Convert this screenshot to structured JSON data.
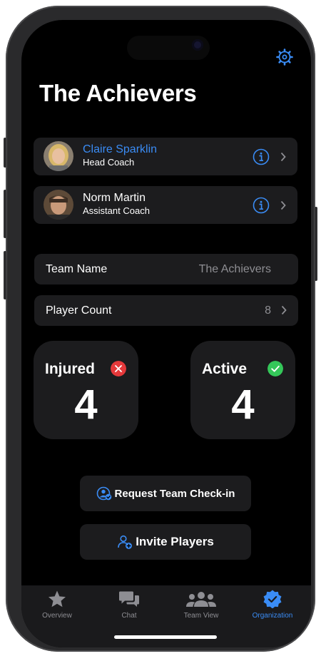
{
  "team_title": "The Achievers",
  "coaches": [
    {
      "name": "Claire Sparklin",
      "role": "Head Coach",
      "name_is_link": true
    },
    {
      "name": "Norm Martin",
      "role": "Assistant Coach",
      "name_is_link": false
    }
  ],
  "team_name_row": {
    "label": "Team Name",
    "value": "The Achievers"
  },
  "player_count_row": {
    "label": "Player Count",
    "value": "8"
  },
  "stats": {
    "injured": {
      "label": "Injured",
      "count": "4"
    },
    "active": {
      "label": "Active",
      "count": "4"
    }
  },
  "actions": {
    "check_in": "Request Team Check-in",
    "invite": "Invite Players"
  },
  "tabs": [
    {
      "label": "Overview",
      "icon": "star-icon"
    },
    {
      "label": "Chat",
      "icon": "chat-bubbles-icon"
    },
    {
      "label": "Team View",
      "icon": "people-icon"
    },
    {
      "label": "Organization",
      "icon": "verified-badge-icon",
      "active": true
    }
  ],
  "colors": {
    "accent": "#3a8cf5",
    "injured": "#e5393b",
    "active": "#34c759",
    "card": "#1c1c1e",
    "background": "#000000"
  }
}
